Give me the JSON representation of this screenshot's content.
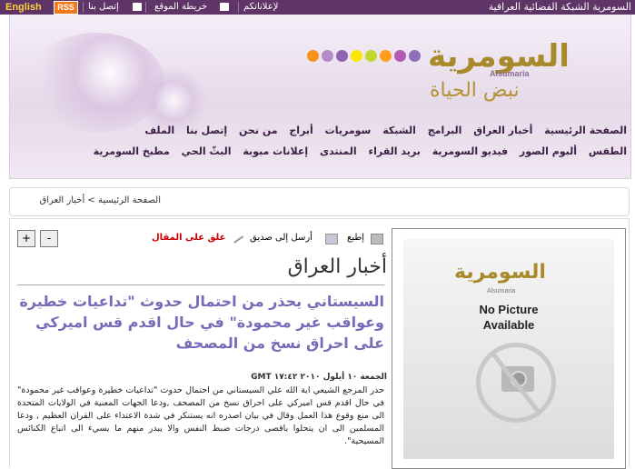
{
  "topbar": {
    "english": "English",
    "rss": "RSS",
    "contact": "إتصل بنا",
    "sitemap": "خريطة الموقع",
    "ads": "لإعلاناتكم",
    "site_name": "السومرية الشبكة الفضائية العراقية",
    "bg_color": "#5e3566"
  },
  "header": {
    "logo": "السومرية",
    "logo_sub": "Alsumaria",
    "slogan": "نبض الحياة",
    "dot_colors": [
      "#f7941d",
      "#b78ac8",
      "#8e63b4",
      "#ffe600",
      "#c2d82f",
      "#ff9f1c",
      "#b35bb6",
      "#8f6fb8"
    ],
    "nav_row1": [
      "الصفحة الرئيسية",
      "أخبار العراق",
      "البرامج",
      "الشبكة",
      "سومريات",
      "أبراج",
      "من نحن",
      "إتصل بنا",
      "الملف"
    ],
    "nav_row2": [
      "الطقس",
      "ألبوم الصور",
      "فيديو السومرية",
      "بريد القراء",
      "المنتدى",
      "إعلانات مبوبة",
      "البثّ الحي",
      "مطبخ السومرية"
    ]
  },
  "breadcrumb": {
    "home": "الصفحة الرئيسية",
    "separator": ">",
    "current": "أخبار العراق"
  },
  "article": {
    "print": "إطبع",
    "send": "أرسل إلى صديق",
    "comment": "علق على المقال",
    "plus": "+",
    "minus": "-",
    "section_title": "أخبار العراق",
    "headline": "السيستاني يحذر من احتمال حدوث \"تداعيات خطيرة وعواقب غير محمودة\" في حال اقدم قس اميركي على احراق نسخ من المصحف",
    "dateline": "الجمعة ١٠ أيلول ٢٠١٠ ١٧:٤٢ GMT",
    "body": "حذر المرجع الشيعي اية الله علي السيستاني من احتمال حدوث \"تداعيات خطيرة وعواقب غير محمودة\" في حال اقدم قس اميركي على احراق نسخ من المصحف ,ودعا الجهات المعنية في الولايات المتحدة الى منع وقوع هذا العمل وقال في بيان اصدره انه يستنكر في شدة الاعتداء على القران العظيم , ودعا المسلمين الى ان يتحلوا باقصى درجات ضبط النفس والا يبدر منهم ما يسيء الى اتباع الكنائس المسيحية\".",
    "headline_color": "#7a68b8",
    "comment_color": "#cc0000"
  },
  "photo": {
    "logo": "السومرية",
    "logo_sub": "Alsumaria",
    "line1": "No Picture",
    "line2": "Available"
  }
}
